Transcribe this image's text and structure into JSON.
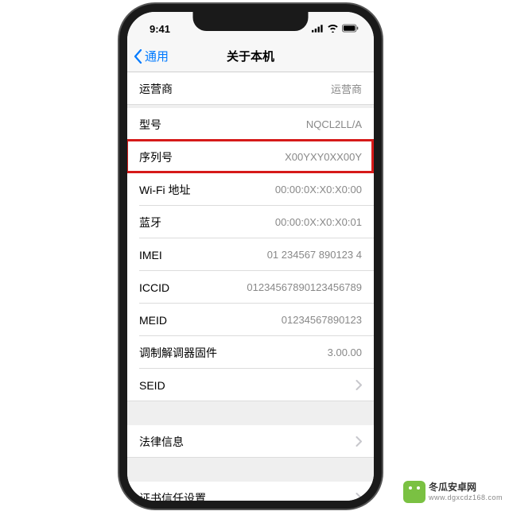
{
  "status": {
    "time": "9:41"
  },
  "nav": {
    "back": "通用",
    "title": "关于本机"
  },
  "groups": [
    {
      "rows": [
        {
          "label": "运营商",
          "value": "运营商",
          "chevron": false,
          "last": true
        }
      ]
    },
    {
      "rows": [
        {
          "label": "型号",
          "value": "NQCL2LL/A",
          "chevron": false
        },
        {
          "label": "序列号",
          "value": "X00YXY0XX00Y",
          "chevron": false,
          "highlight": true
        },
        {
          "label": "Wi-Fi 地址",
          "value": "00:00:0X:X0:X0:00",
          "chevron": false
        },
        {
          "label": "蓝牙",
          "value": "00:00:0X:X0:X0:01",
          "chevron": false
        },
        {
          "label": "IMEI",
          "value": "01 234567 890123 4",
          "chevron": false
        },
        {
          "label": "ICCID",
          "value": "0123456789012345​6789",
          "chevron": false
        },
        {
          "label": "MEID",
          "value": "01234567890123",
          "chevron": false
        },
        {
          "label": "调制解调器固件",
          "value": "3.00.00",
          "chevron": false
        },
        {
          "label": "SEID",
          "value": "",
          "chevron": true,
          "last": true
        }
      ]
    },
    {
      "rows": [
        {
          "label": "法律信息",
          "value": "",
          "chevron": true,
          "last": true
        }
      ]
    },
    {
      "rows": [
        {
          "label": "证书信任设置",
          "value": "",
          "chevron": true,
          "last": true
        }
      ]
    }
  ],
  "brand": {
    "name": "冬瓜安卓网",
    "url": "www.dgxcdz168.com"
  },
  "highlight_color": "#d61a19"
}
